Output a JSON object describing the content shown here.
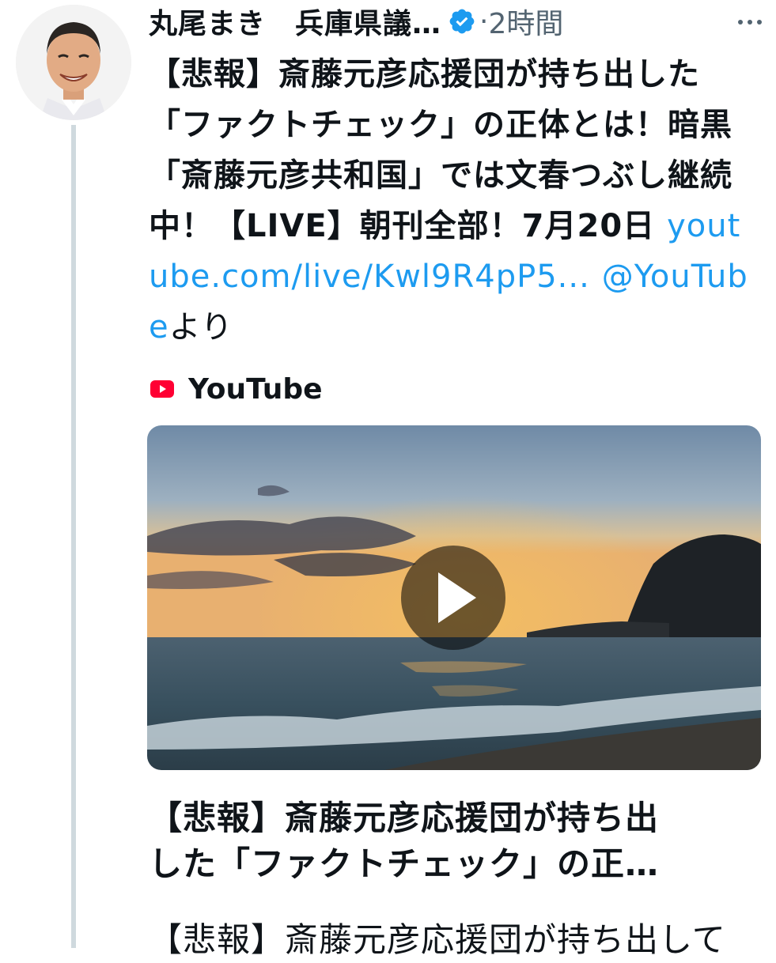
{
  "author": {
    "name": "丸尾まき　兵庫県議…",
    "verified": true,
    "time_separator": "·",
    "time_ago": "2時間",
    "avatar_icon": "avatar-photo"
  },
  "tweet": {
    "text_main": "【悲報】斎藤元彦応援団が持ち出した「ファクトチェック」の正体とは！暗黒「斎藤元彦共和国」では文春つぶし継続中！【LIVE】朝刊全部！7月20日 ",
    "link_text": "youtube.com/live/Kwl9R4pP5...",
    "space": " ",
    "mention_text": "@YouTube",
    "suffix_text": "より"
  },
  "card": {
    "source_label": "YouTube",
    "title_line1": "【悲報】斎藤元彦応援団が持ち出",
    "title_line2": "した「ファクトチェック」の正…",
    "desc_line1": "【悲報】斎藤元彦応援団が持ち出して"
  },
  "colors": {
    "link": "#1d9bf0",
    "verified": "#1d9bf0",
    "meta": "#536471",
    "youtube_red": "#ff0033",
    "thread_line": "#cfd9de"
  },
  "icons": {
    "verified": "verified-badge-icon",
    "more": "more-options-icon",
    "youtube": "youtube-logo-icon",
    "play": "play-icon"
  }
}
